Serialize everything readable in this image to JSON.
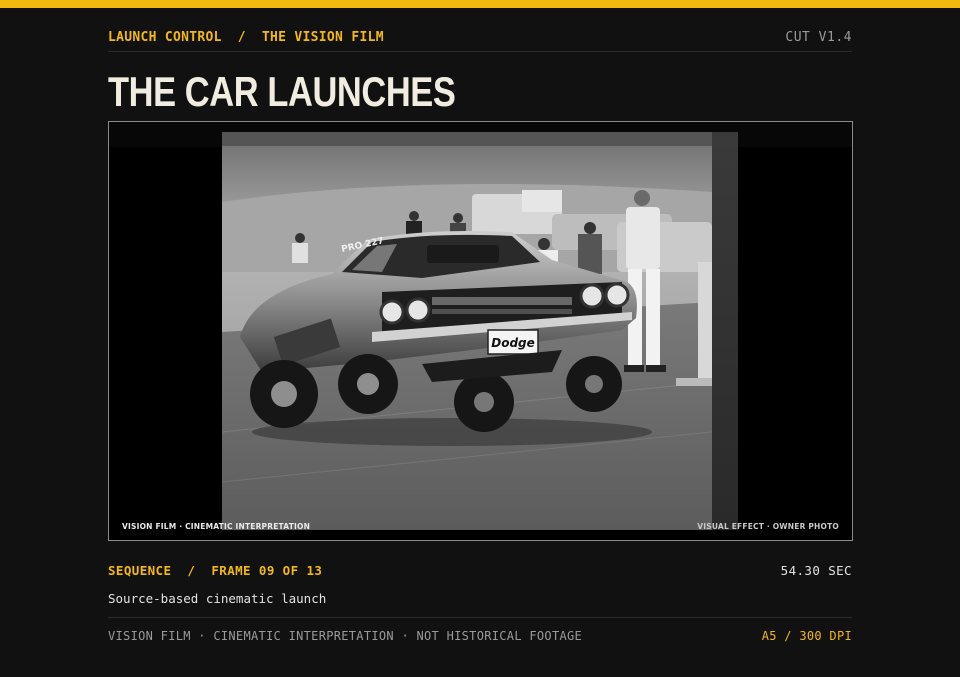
{
  "theme": {
    "accent": "#f2b90f",
    "background": "#111111",
    "title_color": "#f0ecdf",
    "muted": "#9a9a9a"
  },
  "header": {
    "crumbs": [
      "LAUNCH CONTROL",
      "/",
      "THE VISION FILM"
    ],
    "version": "CUT V1.4"
  },
  "title": "THE CAR LAUNCHES",
  "image": {
    "caption_left": "VISION FILM · CINEMATIC INTERPRETATION",
    "caption_right": "VISUAL EFFECT · OWNER PHOTO",
    "plate_text": "Dodge",
    "number_text": "PRO 227"
  },
  "sequence": {
    "label": "SEQUENCE",
    "separator": "/",
    "frame": "FRAME 09 OF 13",
    "duration": "54.30 SEC",
    "description": "Source-based cinematic launch"
  },
  "footer": {
    "note": "VISION FILM · CINEMATIC INTERPRETATION · NOT HISTORICAL FOOTAGE",
    "spec": "A5 / 300 DPI"
  }
}
